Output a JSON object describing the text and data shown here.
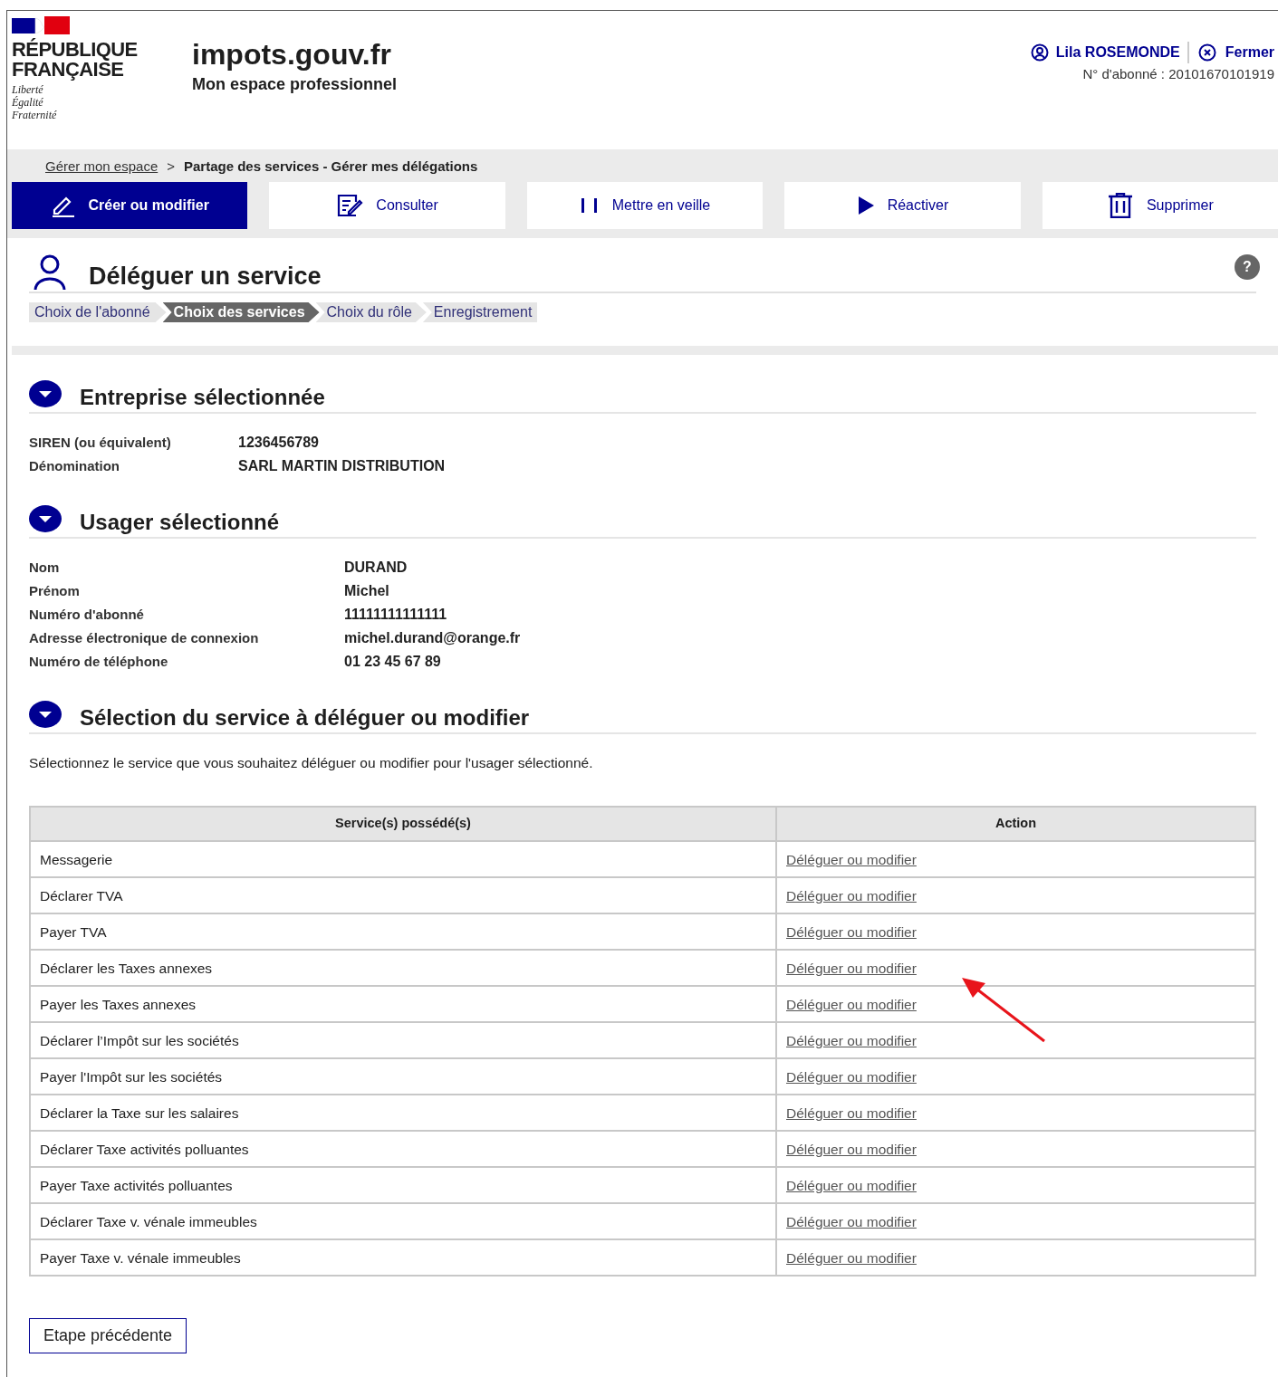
{
  "header": {
    "republic": [
      "RÉPUBLIQUE",
      "FRANÇAISE"
    ],
    "motto": [
      "Liberté",
      "Égalité",
      "Fraternité"
    ],
    "site_title": "impots.gouv.fr",
    "site_subtitle": "Mon espace professionnel",
    "user_name": "Lila ROSEMONDE",
    "close_link": "Fermer",
    "subscriber": "N° d'abonné : 20101670101919"
  },
  "breadcrumb": [
    {
      "label": "Gérer mon espace",
      "kind": "link"
    },
    {
      "label": ">",
      "kind": "separator"
    },
    {
      "label": "Partage des services - Gérer mes délégations",
      "kind": "current"
    }
  ],
  "actions": [
    {
      "label": "Créer ou modifier",
      "kind": "pencil",
      "selected": true
    },
    {
      "label": "Consulter",
      "kind": "form",
      "selected": false
    },
    {
      "label": "Mettre en veille",
      "kind": "pause",
      "selected": false
    },
    {
      "label": "Réactiver",
      "kind": "play",
      "selected": false
    },
    {
      "label": "Supprimer",
      "kind": "trash",
      "selected": false
    }
  ],
  "page_title": "Déléguer un service",
  "help": "?",
  "steps": [
    {
      "label": "Choix de l'abonné",
      "selected": false
    },
    {
      "label": "Choix des services",
      "selected": true
    },
    {
      "label": "Choix du rôle",
      "selected": false
    },
    {
      "label": "Enregistrement",
      "selected": false
    }
  ],
  "company": {
    "title": "Entreprise sélectionnée",
    "fields": [
      {
        "label": "SIREN (ou équivalent)",
        "value": "1236456789"
      },
      {
        "label": "Dénomination",
        "value": "SARL MARTIN DISTRIBUTION"
      }
    ]
  },
  "user": {
    "title": "Usager sélectionné",
    "fields": [
      {
        "label": "Nom",
        "value": "DURAND"
      },
      {
        "label": "Prénom",
        "value": "Michel"
      },
      {
        "label": "Numéro d'abonné",
        "value": "11111111111111"
      },
      {
        "label": "Adresse électronique de connexion",
        "value": "michel.durand@orange.fr"
      },
      {
        "label": "Numéro de téléphone",
        "value": "01 23 45 67 89"
      }
    ]
  },
  "services": {
    "title": "Sélection du service à déléguer ou modifier",
    "description": "Sélectionnez le service que vous souhaitez déléguer ou modifier pour l'usager sélectionné.",
    "columns": [
      "Service(s) possédé(s)",
      "Action"
    ],
    "rows": [
      {
        "service": "Messagerie",
        "action": "Déléguer ou modifier"
      },
      {
        "service": "Déclarer TVA",
        "action": "Déléguer ou modifier"
      },
      {
        "service": "Payer TVA",
        "action": "Déléguer ou modifier"
      },
      {
        "service": "Déclarer les Taxes annexes",
        "action": "Déléguer ou modifier"
      },
      {
        "service": "Payer les Taxes annexes",
        "action": "Déléguer ou modifier"
      },
      {
        "service": "Déclarer l’Impôt sur les sociétés",
        "action": "Déléguer ou modifier"
      },
      {
        "service": "Payer l'Impôt sur les sociétés",
        "action": "Déléguer ou modifier"
      },
      {
        "service": "Déclarer la Taxe sur les salaires",
        "action": "Déléguer ou modifier"
      },
      {
        "service": "Déclarer Taxe activités polluantes",
        "action": "Déléguer ou modifier"
      },
      {
        "service": "Payer Taxe activités polluantes",
        "action": "Déléguer ou modifier"
      },
      {
        "service": "Déclarer Taxe v. vénale immeubles",
        "action": "Déléguer ou modifier"
      },
      {
        "service": "Payer Taxe v. vénale immeubles",
        "action": "Déléguer ou modifier"
      }
    ]
  },
  "back_button": "Etape précédente"
}
